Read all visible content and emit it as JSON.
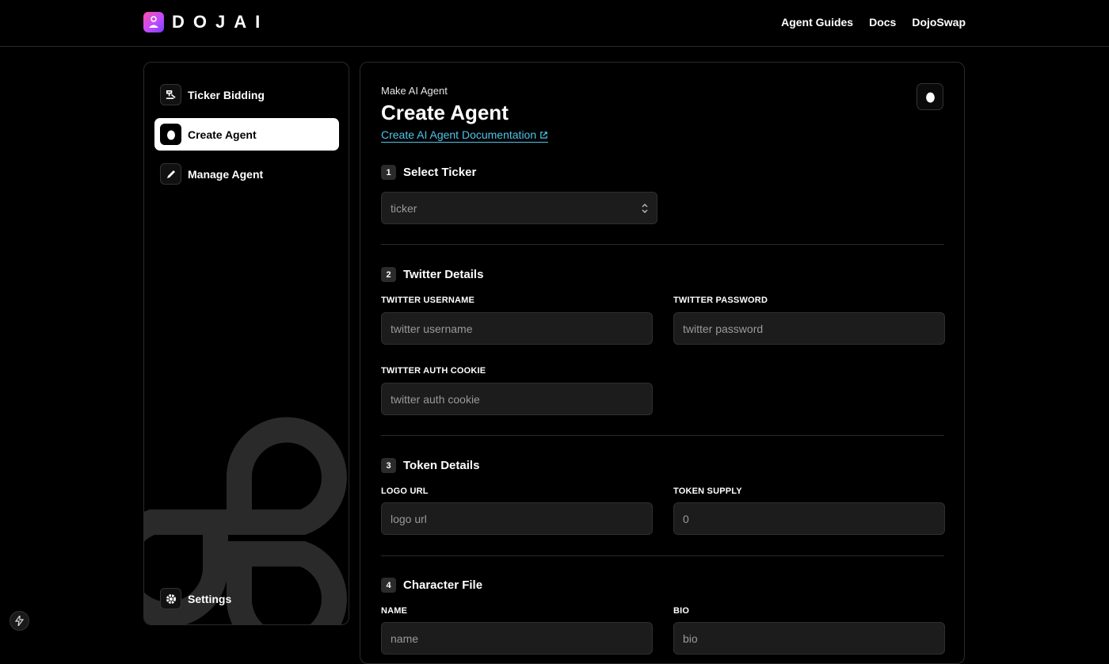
{
  "header": {
    "logo_text": "DOJAI",
    "nav": [
      {
        "label": "Agent Guides"
      },
      {
        "label": "Docs"
      },
      {
        "label": "DojoSwap"
      }
    ]
  },
  "sidebar": {
    "items": [
      {
        "label": "Ticker Bidding",
        "icon": "gavel-icon"
      },
      {
        "label": "Create Agent",
        "icon": "egg-icon",
        "active": true
      },
      {
        "label": "Manage Agent",
        "icon": "pencil-icon"
      }
    ],
    "settings_label": "Settings"
  },
  "main": {
    "eyebrow": "Make AI Agent",
    "title": "Create Agent",
    "doc_link": "Create AI Agent Documentation",
    "sections": {
      "ticker": {
        "num": "1",
        "title": "Select Ticker",
        "select_value": "ticker"
      },
      "twitter": {
        "num": "2",
        "title": "Twitter Details",
        "username_label": "TWITTER USERNAME",
        "username_placeholder": "twitter username",
        "password_label": "TWITTER PASSWORD",
        "password_placeholder": "twitter password",
        "cookie_label": "TWITTER AUTH COOKIE",
        "cookie_placeholder": "twitter auth cookie"
      },
      "token": {
        "num": "3",
        "title": "Token Details",
        "logo_label": "LOGO URL",
        "logo_placeholder": "logo url",
        "supply_label": "TOKEN SUPPLY",
        "supply_value": "0"
      },
      "character": {
        "num": "4",
        "title": "Character File",
        "name_label": "NAME",
        "name_placeholder": "name",
        "bio_label": "BIO",
        "bio_placeholder": "bio"
      }
    }
  },
  "colors": {
    "link": "#4fc3e8",
    "field_bg": "#1c1c1c",
    "active_bg": "#ffffff"
  }
}
